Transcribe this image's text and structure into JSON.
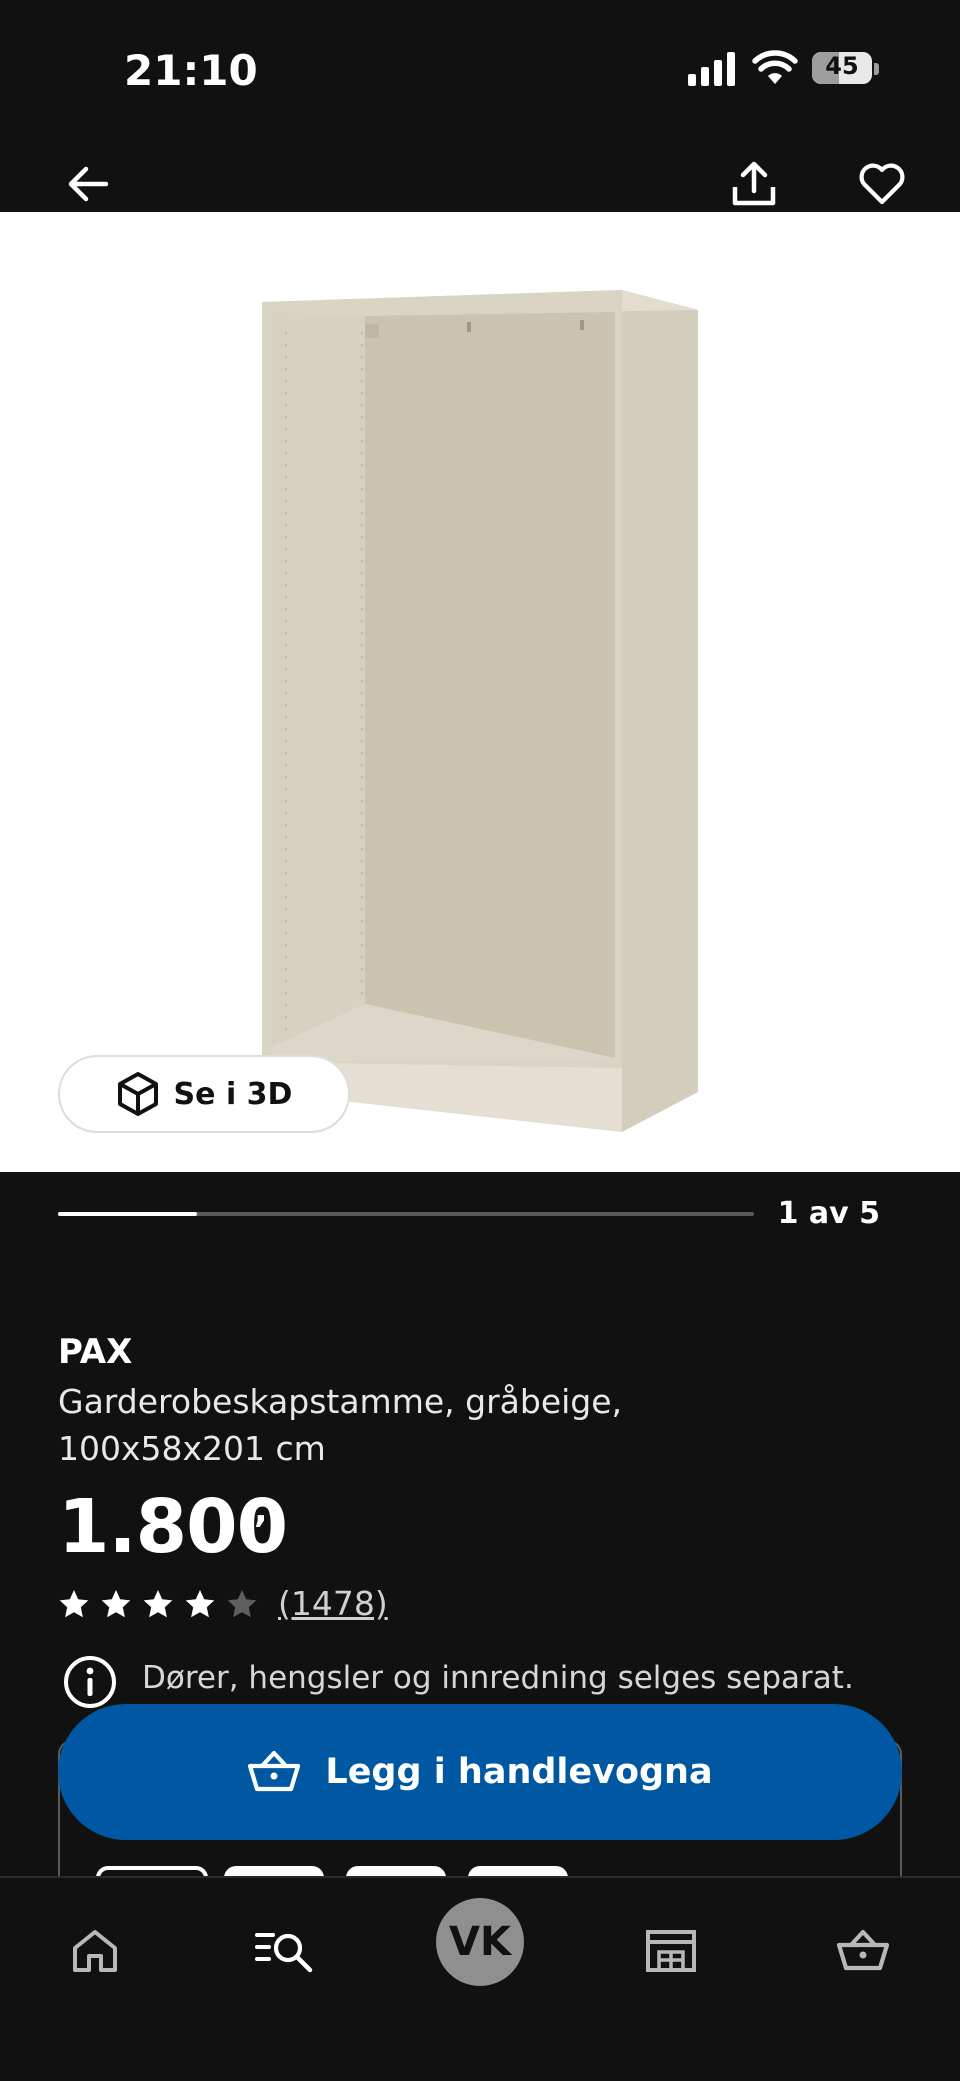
{
  "status_bar": {
    "time": "21:10",
    "battery": "45",
    "battery_fraction": 0.45
  },
  "header": {
    "back_icon": "arrow-left-icon",
    "share_icon": "share-icon",
    "favorite_icon": "heart-icon"
  },
  "gallery": {
    "view_3d_label": "Se i 3D",
    "view_3d_icon": "cube-icon",
    "counter": "1 av 5",
    "progress_fraction": 0.2
  },
  "product": {
    "brand": "PAX",
    "description": "Garderobeskapstamme, gråbeige, 100x58x201 cm",
    "price": "1.800",
    "price_suffix": ",-",
    "rating_stars": 4,
    "rating_max": 5,
    "rating_count": "(1478)",
    "info_text": "Dører, hengsler og innredning selges separat."
  },
  "cta": {
    "label": "Legg i handlevogna",
    "icon": "basket-icon",
    "color": "#0058a3"
  },
  "bottom_nav": {
    "items": [
      {
        "name": "home",
        "icon": "home-icon"
      },
      {
        "name": "search",
        "icon": "search-list-icon"
      },
      {
        "name": "profile",
        "avatar": "VK"
      },
      {
        "name": "store",
        "icon": "store-icon"
      },
      {
        "name": "cart",
        "icon": "basket-icon"
      }
    ]
  }
}
